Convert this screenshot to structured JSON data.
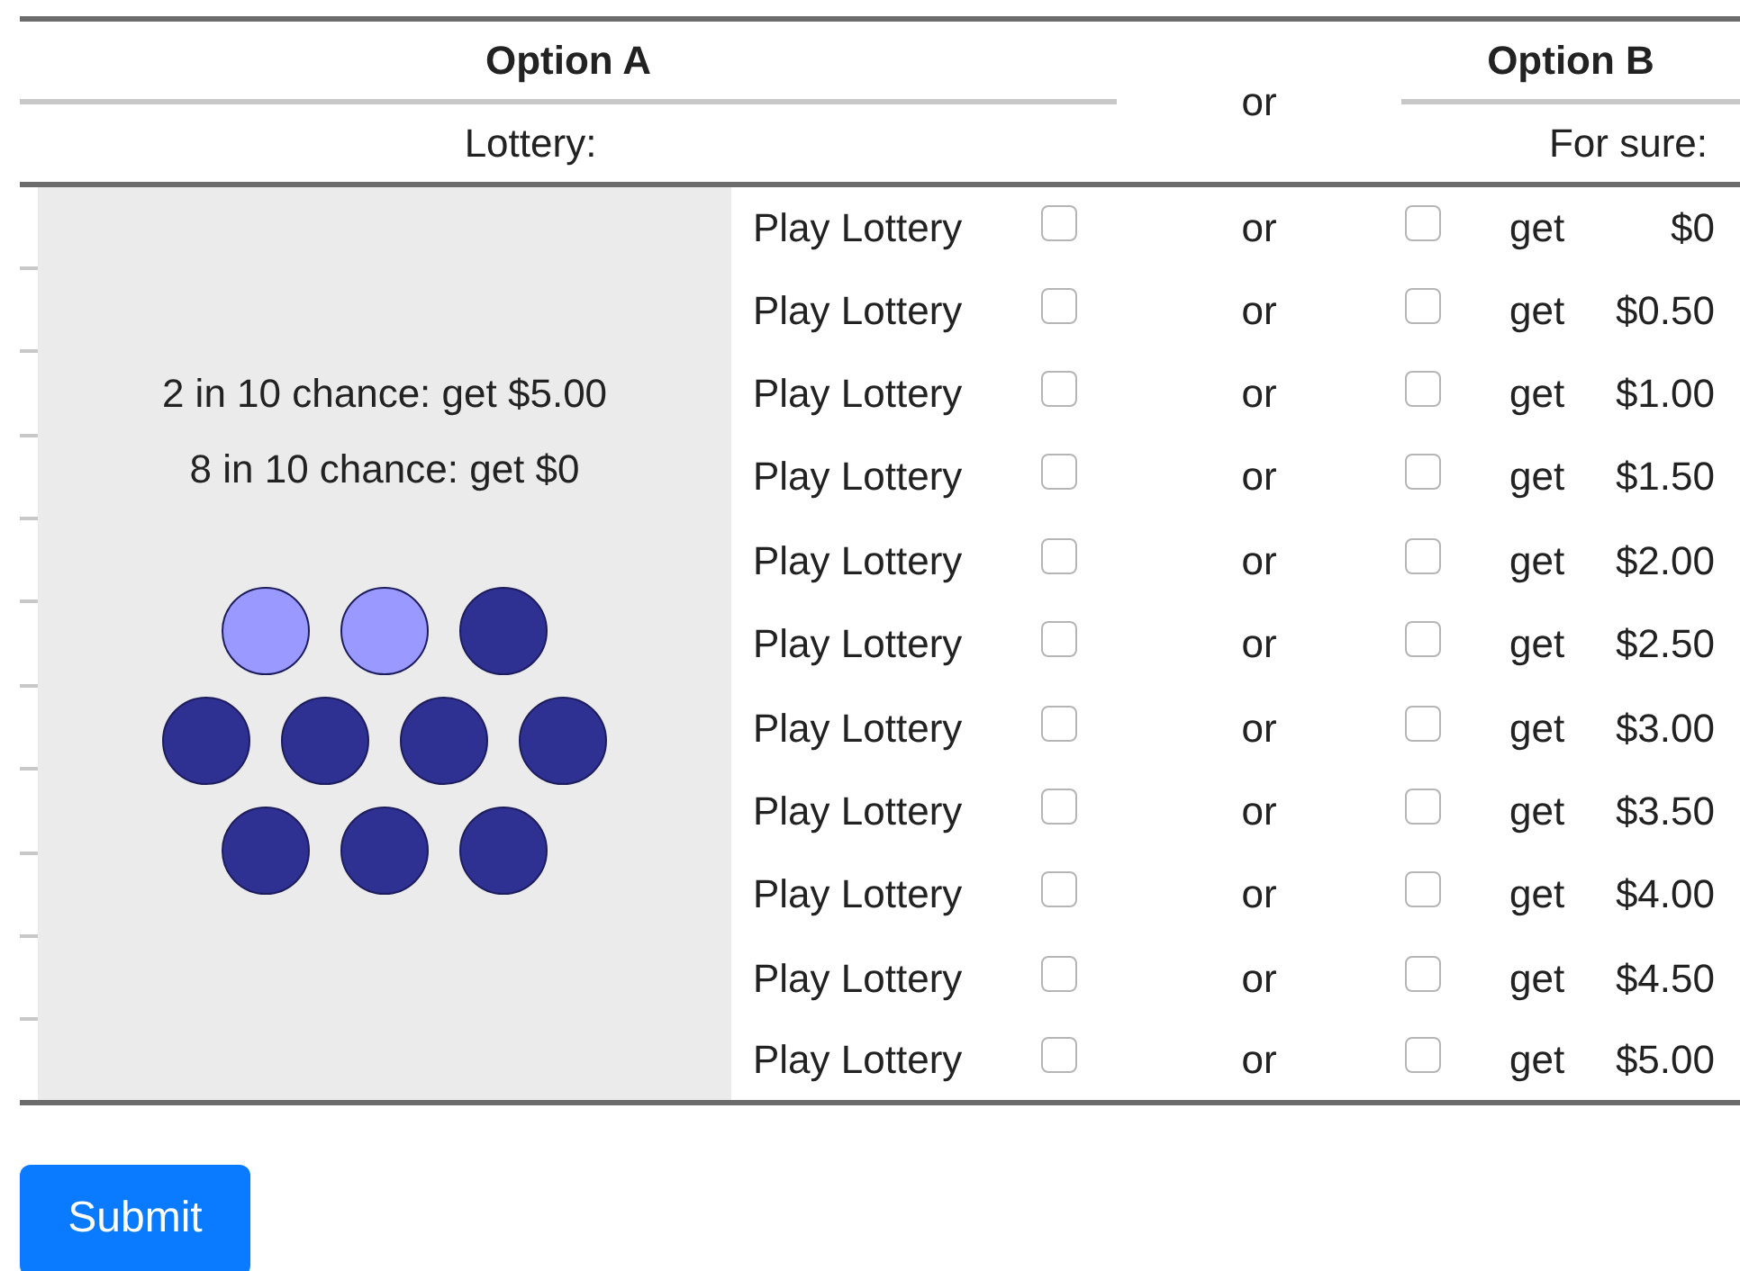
{
  "header": {
    "option_a": "Option A",
    "or": "or",
    "option_b": "Option B",
    "lottery_label": "Lottery:",
    "sure_label": "For sure:"
  },
  "lottery": {
    "lines": [
      "2 in 10 chance: get $5.00",
      "8 in 10 chance: get $0"
    ],
    "ball_rows": [
      {
        "balls": [
          {
            "color": "#9999ff"
          },
          {
            "color": "#9999ff"
          },
          {
            "color": "#2e3192"
          }
        ]
      },
      {
        "balls": [
          {
            "color": "#2e3192"
          },
          {
            "color": "#2e3192"
          },
          {
            "color": "#2e3192"
          },
          {
            "color": "#2e3192"
          }
        ]
      },
      {
        "balls": [
          {
            "color": "#2e3192"
          },
          {
            "color": "#2e3192"
          },
          {
            "color": "#2e3192"
          }
        ]
      }
    ]
  },
  "rows": [
    {
      "lottery": "Play Lottery",
      "lottery_checked": false,
      "or": "or",
      "sure_checked": false,
      "get": "get",
      "amount": "$0"
    },
    {
      "lottery": "Play Lottery",
      "lottery_checked": false,
      "or": "or",
      "sure_checked": false,
      "get": "get",
      "amount": "$0.50"
    },
    {
      "lottery": "Play Lottery",
      "lottery_checked": false,
      "or": "or",
      "sure_checked": false,
      "get": "get",
      "amount": "$1.00"
    },
    {
      "lottery": "Play Lottery",
      "lottery_checked": false,
      "or": "or",
      "sure_checked": false,
      "get": "get",
      "amount": "$1.50"
    },
    {
      "lottery": "Play Lottery",
      "lottery_checked": false,
      "or": "or",
      "sure_checked": false,
      "get": "get",
      "amount": "$2.00"
    },
    {
      "lottery": "Play Lottery",
      "lottery_checked": false,
      "or": "or",
      "sure_checked": false,
      "get": "get",
      "amount": "$2.50"
    },
    {
      "lottery": "Play Lottery",
      "lottery_checked": false,
      "or": "or",
      "sure_checked": false,
      "get": "get",
      "amount": "$3.00"
    },
    {
      "lottery": "Play Lottery",
      "lottery_checked": false,
      "or": "or",
      "sure_checked": false,
      "get": "get",
      "amount": "$3.50"
    },
    {
      "lottery": "Play Lottery",
      "lottery_checked": false,
      "or": "or",
      "sure_checked": false,
      "get": "get",
      "amount": "$4.00"
    },
    {
      "lottery": "Play Lottery",
      "lottery_checked": false,
      "or": "or",
      "sure_checked": false,
      "get": "get",
      "amount": "$4.50"
    },
    {
      "lottery": "Play Lottery",
      "lottery_checked": false,
      "or": "or",
      "sure_checked": false,
      "get": "get",
      "amount": "$5.00"
    }
  ],
  "submit": "Submit"
}
